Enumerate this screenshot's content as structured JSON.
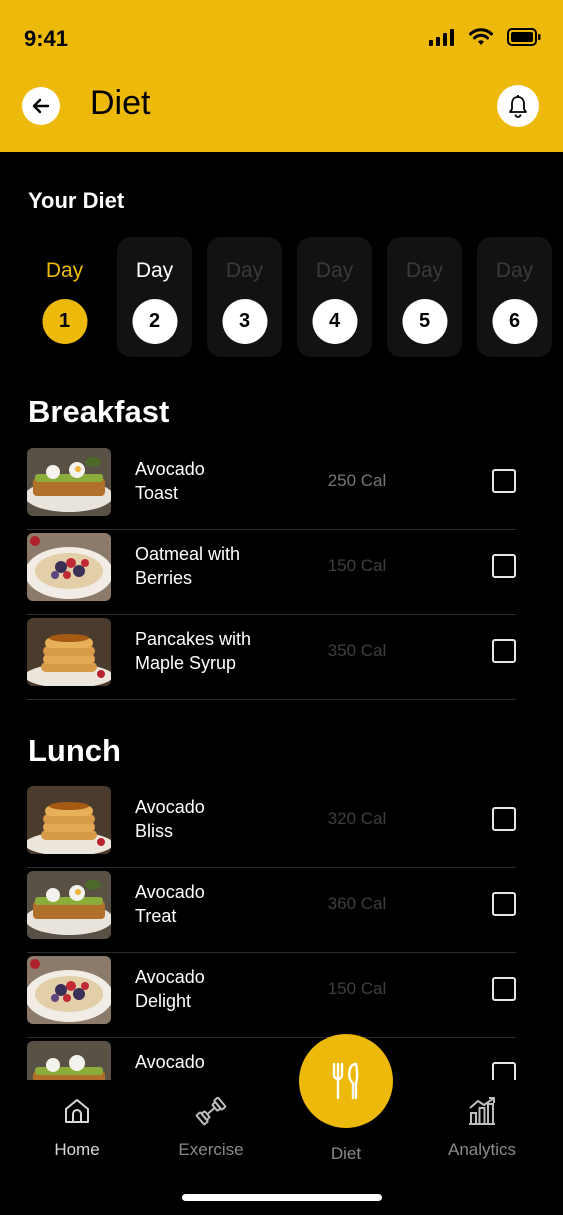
{
  "status_bar": {
    "time": "9:41"
  },
  "header": {
    "title": "Diet"
  },
  "section_title": "Your Diet",
  "days": [
    {
      "label": "Day",
      "number": "1",
      "state": "active"
    },
    {
      "label": "Day",
      "number": "2",
      "state": "normal"
    },
    {
      "label": "Day",
      "number": "3",
      "state": "dim"
    },
    {
      "label": "Day",
      "number": "4",
      "state": "dim"
    },
    {
      "label": "Day",
      "number": "5",
      "state": "dim"
    },
    {
      "label": "Day",
      "number": "6",
      "state": "dim"
    }
  ],
  "breakfast": {
    "title": "Breakfast",
    "items": [
      {
        "name_line1": "Avocado",
        "name_line2": "Toast",
        "cal": "250 Cal",
        "image": "avocado-toast"
      },
      {
        "name_line1": "Oatmeal with",
        "name_line2": "Berries",
        "cal": "150 Cal",
        "image": "oatmeal-berries"
      },
      {
        "name_line1": "Pancakes with",
        "name_line2": "Maple Syrup",
        "cal": "350 Cal",
        "image": "pancakes"
      }
    ]
  },
  "lunch": {
    "title": "Lunch",
    "items": [
      {
        "name_line1": "Avocado",
        "name_line2": "Bliss",
        "cal": "320 Cal",
        "image": "pancakes"
      },
      {
        "name_line1": "Avocado",
        "name_line2": "Treat",
        "cal": "360 Cal",
        "image": "avocado-toast"
      },
      {
        "name_line1": "Avocado",
        "name_line2": "Delight",
        "cal": "150 Cal",
        "image": "oatmeal-berries"
      },
      {
        "name_line1": "Avocado",
        "name_line2": "",
        "cal": "",
        "image": "avocado-toast"
      }
    ]
  },
  "nav": {
    "home": "Home",
    "exercise": "Exercise",
    "diet": "Diet",
    "analytics": "Analytics"
  },
  "colors": {
    "accent": "#EDB90B",
    "background": "#000000"
  }
}
